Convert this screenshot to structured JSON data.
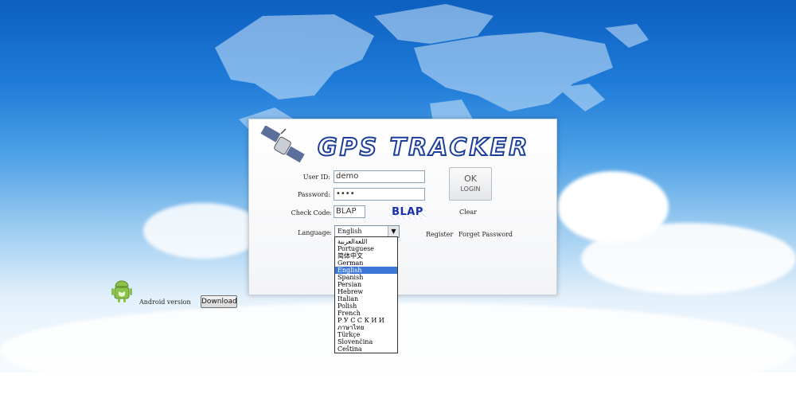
{
  "logo": {
    "text": "GPS TRACKER"
  },
  "form": {
    "user_id_label": "User ID:",
    "user_id_value": "demo",
    "password_label": "Password:",
    "password_value": "••••",
    "check_code_label": "Check Code:",
    "check_code_value": "BLAP",
    "captcha_text": "BLAP",
    "language_label": "Language:",
    "language_selected": "English"
  },
  "buttons": {
    "ok_label": "OK",
    "login_label": "LOGIN",
    "clear_label": "Clear",
    "register_label": "Register",
    "forget_label": "Forget Password"
  },
  "language_options": [
    "اللغةالعربية",
    "Portuguese",
    "简体中文",
    "German",
    "English",
    "Spanish",
    "Persian",
    "Hebrew",
    "Italian",
    "Polish",
    "French",
    "Р У С С К И Й",
    "ภาษาไทย",
    "Türkçe",
    "Slovenčina",
    "Čeština"
  ],
  "selected_language_index": 4,
  "android": {
    "label": "Android version",
    "download_label": "Download"
  },
  "colors": {
    "accent": "#1d3f9a",
    "selection": "#3c78d8"
  }
}
